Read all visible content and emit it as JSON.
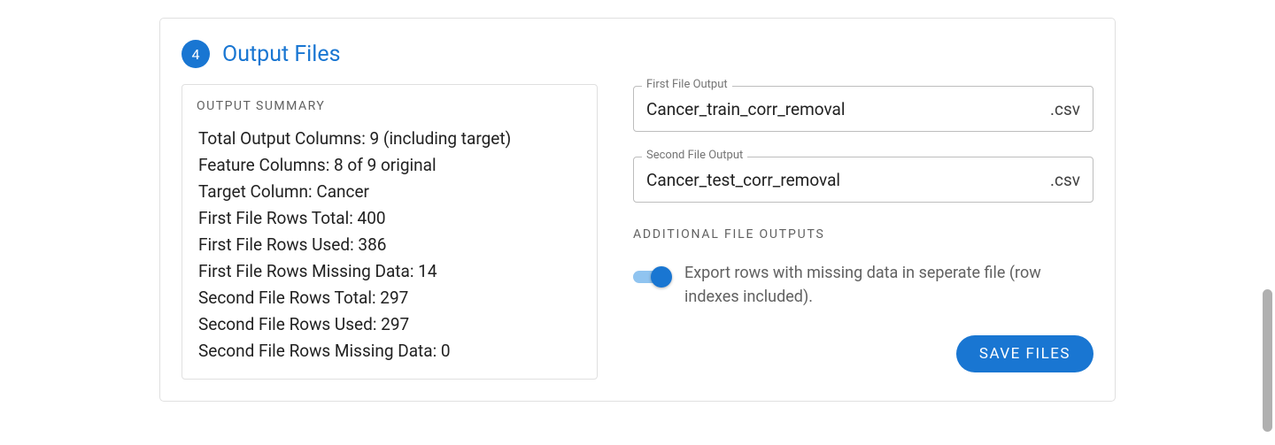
{
  "step": {
    "number": "4",
    "title": "Output Files"
  },
  "summary": {
    "heading": "Output Summary",
    "lines": [
      "Total Output Columns: 9 (including target)",
      "Feature Columns: 8 of 9 original",
      "Target Column: Cancer",
      "First File Rows Total: 400",
      "First File Rows Used: 386",
      "First File Rows Missing Data: 14",
      "Second File Rows Total: 297",
      "Second File Rows Used: 297",
      "Second File Rows Missing Data: 0"
    ]
  },
  "outputs": {
    "first": {
      "label": "First File Output",
      "value": "Cancer_train_corr_removal",
      "suffix": ".csv"
    },
    "second": {
      "label": "Second File Output",
      "value": "Cancer_test_corr_removal",
      "suffix": ".csv"
    }
  },
  "additional": {
    "heading": "Additional File Outputs",
    "toggle_label": "Export rows with missing data in seperate file (row indexes included).",
    "toggle_on": true
  },
  "actions": {
    "save": "SAVE FILES"
  }
}
